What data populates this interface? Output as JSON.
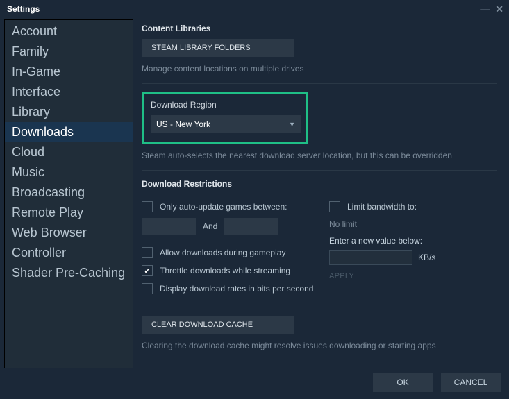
{
  "window": {
    "title": "Settings"
  },
  "sidebar": {
    "items": [
      {
        "label": "Account"
      },
      {
        "label": "Family"
      },
      {
        "label": "In-Game"
      },
      {
        "label": "Interface"
      },
      {
        "label": "Library"
      },
      {
        "label": "Downloads",
        "active": true
      },
      {
        "label": "Cloud"
      },
      {
        "label": "Music"
      },
      {
        "label": "Broadcasting"
      },
      {
        "label": "Remote Play"
      },
      {
        "label": "Web Browser"
      },
      {
        "label": "Controller"
      },
      {
        "label": "Shader Pre-Caching"
      }
    ]
  },
  "content_libraries": {
    "title": "Content Libraries",
    "button": "STEAM LIBRARY FOLDERS",
    "helper": "Manage content locations on multiple drives"
  },
  "download_region": {
    "title": "Download Region",
    "selected": "US - New York",
    "helper": "Steam auto-selects the nearest download server location, but this can be overridden"
  },
  "download_restrictions": {
    "title": "Download Restrictions",
    "auto_update_label": "Only auto-update games between:",
    "and_label": "And",
    "allow_during_gameplay": "Allow downloads during gameplay",
    "throttle_streaming": "Throttle downloads while streaming",
    "bits_per_second": "Display download rates in bits per second",
    "limit_bandwidth_label": "Limit bandwidth to:",
    "no_limit": "No limit",
    "enter_new_value": "Enter a new value below:",
    "unit": "KB/s",
    "apply": "APPLY"
  },
  "cache": {
    "button": "CLEAR DOWNLOAD CACHE",
    "helper": "Clearing the download cache might resolve issues downloading or starting apps"
  },
  "footer": {
    "ok": "OK",
    "cancel": "CANCEL"
  }
}
